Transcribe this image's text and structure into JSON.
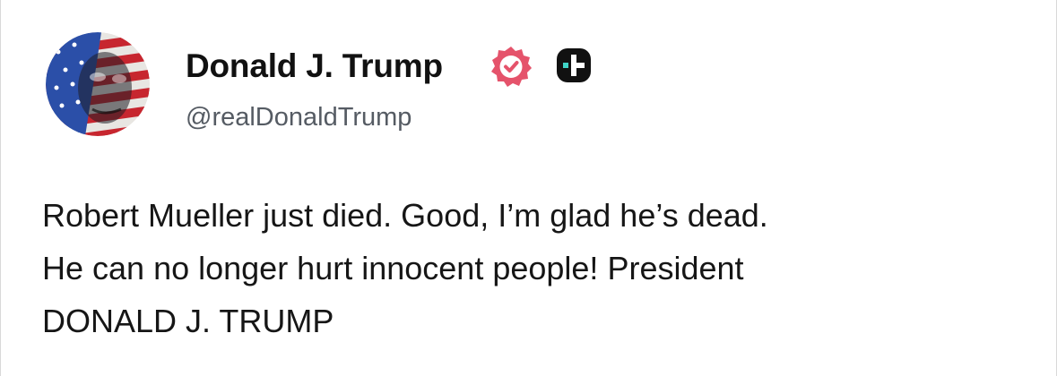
{
  "author": {
    "display_name": "Donald J. Trump",
    "handle": "@realDonaldTrump",
    "verified": true,
    "avatar_icon": "flag-portrait-avatar",
    "badge_icons": [
      "verified-badge-icon",
      "truth-social-icon"
    ]
  },
  "post": {
    "lines": [
      "Robert Mueller just died. Good, I’m glad he’s dead.",
      "He can no longer hurt innocent people! President",
      "DONALD J. TRUMP"
    ]
  },
  "colors": {
    "verified_badge": "#e5536b",
    "truth_icon_bg": "#111111",
    "truth_icon_accent": "#3fd3c6",
    "handle_text": "#555b63"
  }
}
